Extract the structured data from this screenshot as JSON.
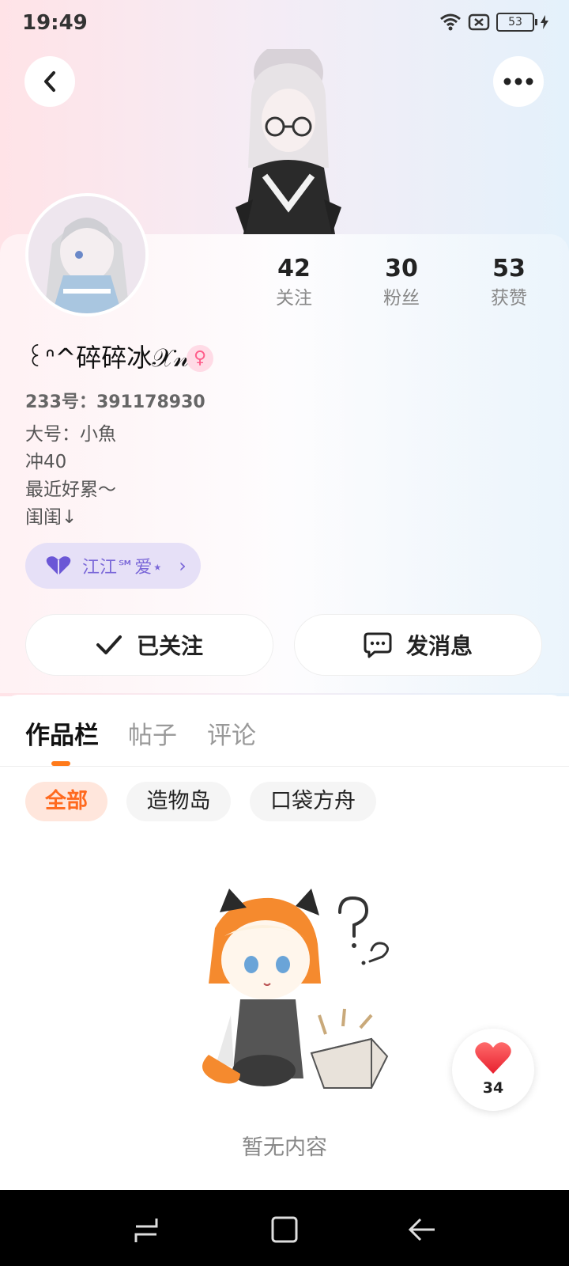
{
  "status_bar": {
    "time": "19:49",
    "battery": "53"
  },
  "header": {
    "back_icon": "chevron-left-icon",
    "more_icon": "more-dots-icon"
  },
  "profile": {
    "nickname": "꒰ᐢ^碎碎冰𝒳𝓃.",
    "gender_icon": "female-icon",
    "gender_color": "#ff5c8a",
    "uid_label": "233号：",
    "uid": "391178930",
    "bio": [
      "大号：小魚",
      "冲40",
      "最近好累～",
      "闺闺↓"
    ],
    "relation_chip": {
      "label": "江江℠爱⋆",
      "icon": "heart-icon"
    }
  },
  "stats": [
    {
      "value": "42",
      "label": "关注"
    },
    {
      "value": "30",
      "label": "粉丝"
    },
    {
      "value": "53",
      "label": "获赞"
    }
  ],
  "actions": {
    "follow_label": "已关注",
    "message_label": "发消息"
  },
  "tabs": [
    {
      "label": "作品栏",
      "active": true
    },
    {
      "label": "帖子",
      "active": false
    },
    {
      "label": "评论",
      "active": false
    }
  ],
  "filters": [
    {
      "label": "全部",
      "active": true
    },
    {
      "label": "造物岛",
      "active": false
    },
    {
      "label": "口袋方舟",
      "active": false
    }
  ],
  "empty_state": {
    "text": "暂无内容"
  },
  "like_fab": {
    "count": "34",
    "icon": "heart-icon"
  },
  "colors": {
    "accent": "#ff7a1a",
    "chip_text": "#7a67d8",
    "chip_bg": "#e6e0f7"
  }
}
